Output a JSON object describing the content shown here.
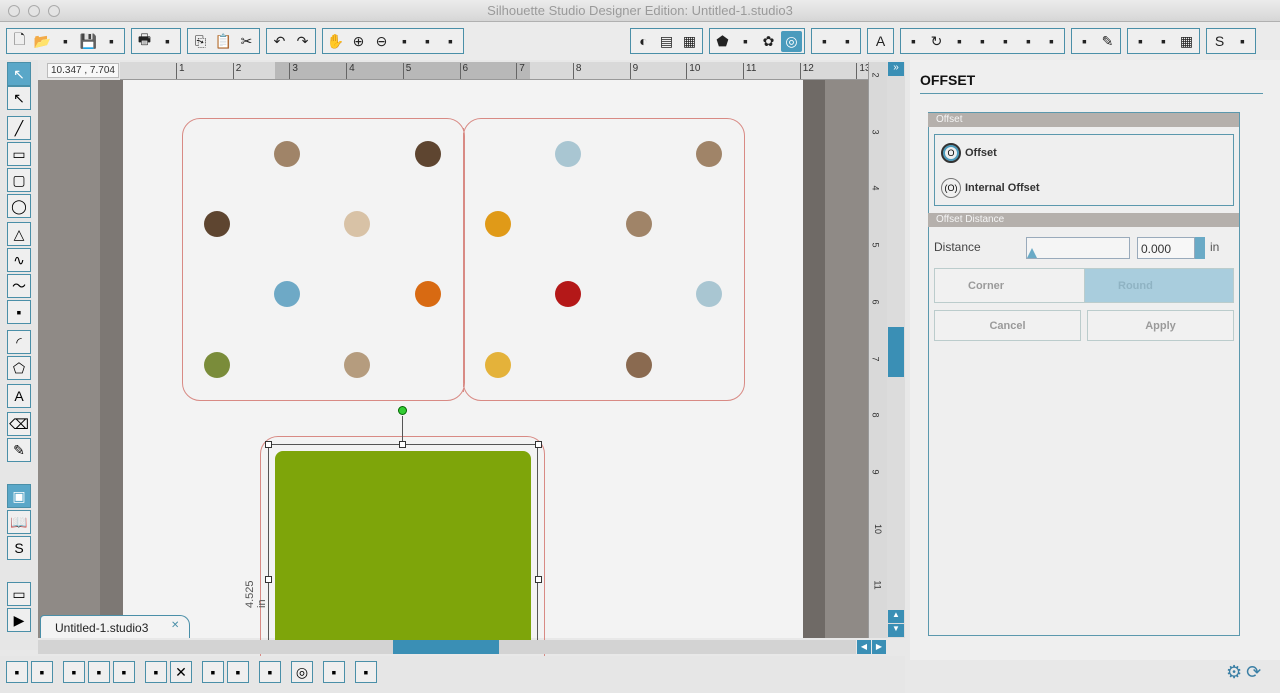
{
  "window": {
    "title": "Silhouette Studio Designer Edition: Untitled-1.studio3"
  },
  "toolbar": {
    "groups": [
      {
        "icons": [
          "new-document-icon",
          "open-folder-icon",
          "template-icon",
          "save-icon",
          "save-to-sd-icon"
        ]
      },
      {
        "icons": [
          "print-icon",
          "send-to-cutter-icon"
        ]
      },
      {
        "icons": [
          "copy-icon",
          "paste-icon",
          "cut-icon"
        ]
      },
      {
        "icons": [
          "undo-icon",
          "redo-icon"
        ]
      },
      {
        "icons": [
          "pan-hand-icon",
          "zoom-in-icon",
          "zoom-out-icon",
          "zoom-select-icon",
          "zoom-drag-icon",
          "fit-to-page-icon"
        ]
      },
      {
        "icons": [
          "fill-color-icon",
          "gradient-icon",
          "pattern-icon"
        ]
      },
      {
        "icons": [
          "line-color-icon",
          "line-style-icon",
          "sketch-icon",
          "offset-icon"
        ],
        "active": 3
      },
      {
        "icons": [
          "line-color-panel-icon",
          "line-style-panel-icon"
        ]
      },
      {
        "icons": [
          "text-icon"
        ]
      },
      {
        "icons": [
          "transform-icon",
          "rotate-icon",
          "scale-icon",
          "shear-icon",
          "align-icon",
          "replicate-icon",
          "modify-icon"
        ]
      },
      {
        "icons": [
          "trace-icon",
          "knife-icon"
        ]
      },
      {
        "icons": [
          "page-setup-icon",
          "cut-settings-icon",
          "grid-icon"
        ]
      },
      {
        "icons": [
          "store-icon",
          "library-icon"
        ]
      }
    ]
  },
  "left_tools": [
    "select-icon",
    "point-edit-icon",
    "line-icon",
    "rectangle-icon",
    "rounded-rectangle-icon",
    "ellipse-icon",
    "polygon-icon",
    "curve-icon",
    "freehand-icon",
    "smooth-freehand-icon",
    "arc-icon",
    "regular-polygon-icon",
    "text-icon",
    "eraser-icon",
    "knife-icon",
    "design-view-icon",
    "library-view-icon",
    "store-icon",
    "show-panel-icon",
    "expand-icon"
  ],
  "canvas": {
    "coords": "10.347 , 7.704",
    "ruler_ticks": [
      "1",
      "2",
      "3",
      "4",
      "5",
      "6",
      "7",
      "8",
      "9",
      "10",
      "11",
      "12",
      "13"
    ],
    "vruler_ticks": [
      "2",
      "3",
      "4",
      "5",
      "6",
      "7",
      "8",
      "9",
      "10",
      "11"
    ],
    "dimension_label": "4.525 in",
    "dots": [
      {
        "c": "#a08468"
      },
      {
        "c": "#5e4530"
      },
      {
        "c": "#a9c6d2"
      },
      {
        "c": "#a08468"
      },
      {
        "c": "#5e4530"
      },
      {
        "c": "#d8c2a6"
      },
      {
        "c": "#e09a18"
      },
      {
        "c": "#a08468"
      },
      {
        "c": "#6ea9c6"
      },
      {
        "c": "#d86a12"
      },
      {
        "c": "#b41818"
      },
      {
        "c": "#a9c6d2"
      },
      {
        "c": "#7a8c3a"
      },
      {
        "c": "#b59c7e"
      },
      {
        "c": "#e4b23a"
      },
      {
        "c": "#8a6a50"
      }
    ],
    "green_fill": "#7ea50a",
    "cut_line_color": "#d88a84"
  },
  "tab": {
    "label": "Untitled-1.studio3"
  },
  "panel": {
    "title": "OFFSET",
    "offset_section": "Offset",
    "options": [
      {
        "label": "Offset",
        "selected": true
      },
      {
        "label": "Internal Offset",
        "selected": false
      }
    ],
    "distance_section": "Offset Distance",
    "distance_label": "Distance",
    "distance_value": "0.000",
    "unit": "in",
    "corner_label": "Corner",
    "round_label": "Round",
    "corner_style": "Round",
    "cancel": "Cancel",
    "apply": "Apply"
  },
  "bottom_tools": [
    "group-icon",
    "ungroup-icon",
    "compound-icon",
    "release-compound-icon",
    "weld-icon",
    "duplicate-icon",
    "delete-icon",
    "bring-forward-icon",
    "send-backward-icon",
    "select-all-icon",
    "offset-icon",
    "trace-icon",
    "replicate-icon"
  ],
  "status_icons": [
    "settings-gear-icon",
    "sync-icon"
  ],
  "accent": "#4a9bbd"
}
